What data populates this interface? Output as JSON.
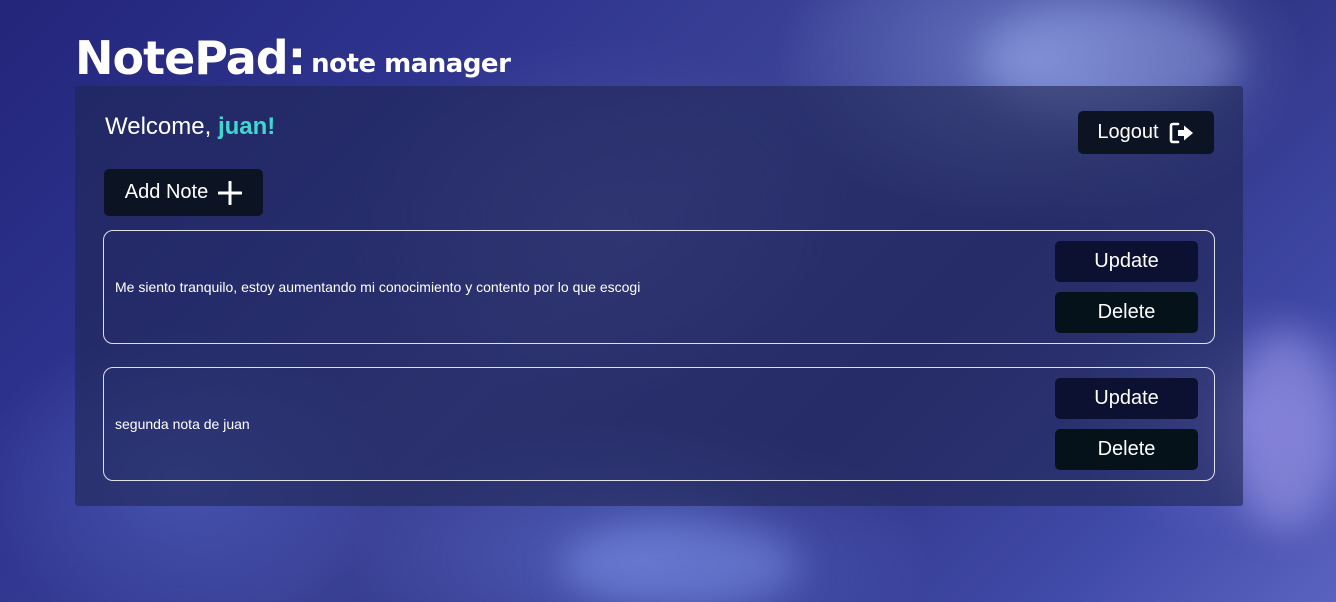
{
  "header": {
    "brand": "NotePad:",
    "tagline": "note manager"
  },
  "welcome": {
    "greeting": "Welcome,",
    "username": "juan!"
  },
  "toolbar": {
    "logout_label": "Logout",
    "logout_icon": "sign-out-icon",
    "add_note_label": "Add Note",
    "add_note_icon": "plus-icon"
  },
  "notes": [
    {
      "text": "Me siento tranquilo, estoy aumentando mi conocimiento y contento por lo que escogi",
      "update_label": "Update",
      "delete_label": "Delete"
    },
    {
      "text": "segunda nota de juan",
      "update_label": "Update",
      "delete_label": "Delete"
    }
  ],
  "colors": {
    "accent_username": "#3fd8d0",
    "button_dark": "#0c1424"
  }
}
